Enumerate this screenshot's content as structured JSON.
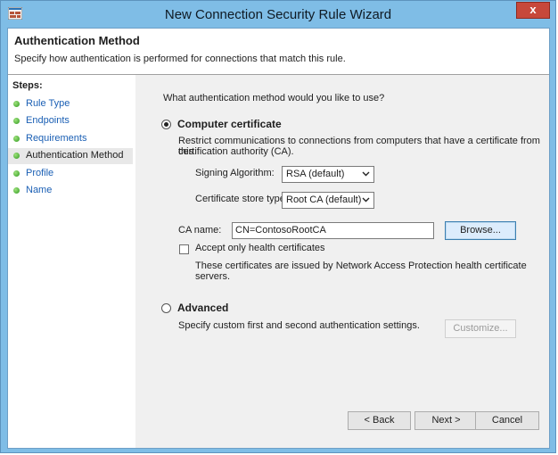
{
  "window": {
    "title": "New Connection Security Rule Wizard",
    "close_label": "x"
  },
  "header": {
    "title": "Authentication Method",
    "description": "Specify how authentication is performed for connections that match this rule."
  },
  "steps": {
    "title": "Steps:",
    "items": [
      {
        "label": "Rule Type"
      },
      {
        "label": "Endpoints"
      },
      {
        "label": "Requirements"
      },
      {
        "label": "Authentication Method",
        "active": true
      },
      {
        "label": "Profile"
      },
      {
        "label": "Name"
      }
    ]
  },
  "main": {
    "question": "What authentication method would you like to use?",
    "computer_certificate": {
      "label": "Computer certificate",
      "selected": true,
      "description_line1": "Restrict communications to connections from computers that have a certificate from this",
      "description_line2": "certification authority (CA).",
      "signing_algorithm": {
        "label": "Signing Algorithm:",
        "value": "RSA (default)"
      },
      "certificate_store_type": {
        "label": "Certificate store type:",
        "value": "Root CA (default)"
      },
      "ca_name": {
        "label": "CA name:",
        "value": "CN=ContosoRootCA"
      },
      "browse_label": "Browse...",
      "health_checkbox": {
        "label": "Accept only health certificates",
        "checked": false,
        "note_line1": "These certificates are issued by Network Access Protection health certificate",
        "note_line2": "servers."
      }
    },
    "advanced": {
      "label": "Advanced",
      "selected": false,
      "description": "Specify custom first and second authentication settings.",
      "customize_label": "Customize..."
    }
  },
  "footer": {
    "back_label": "< Back",
    "next_label": "Next >",
    "cancel_label": "Cancel"
  }
}
